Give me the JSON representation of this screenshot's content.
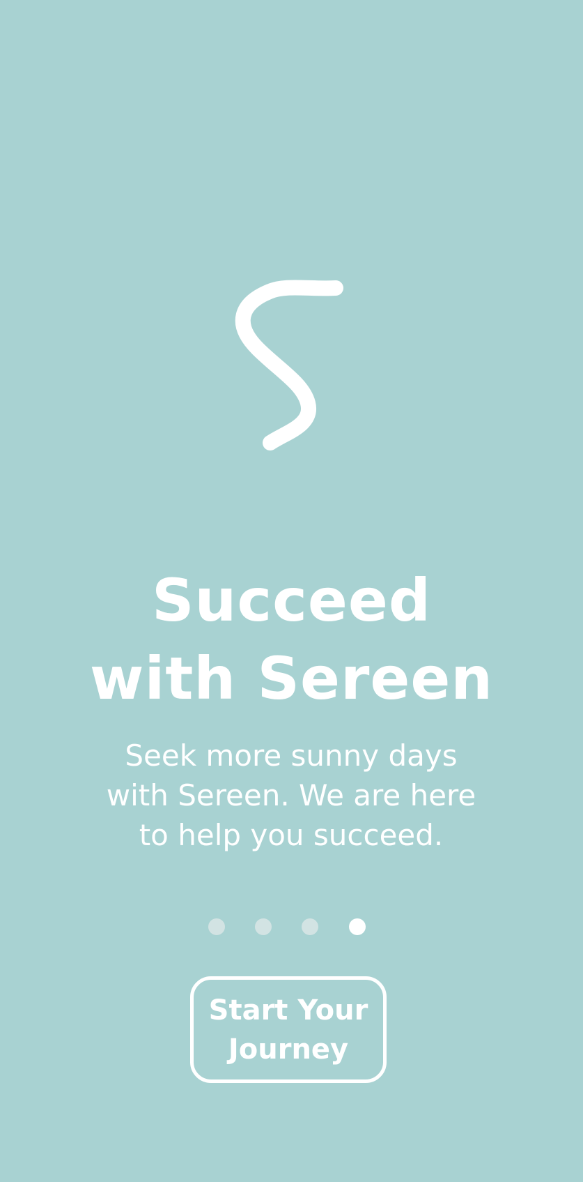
{
  "colors": {
    "background": "#a8d2d2",
    "foreground": "#ffffff",
    "dot_inactive": "#d2e3e3",
    "dot_active": "#ffffff"
  },
  "logo": {
    "icon": "sereen-s-logo-icon"
  },
  "onboarding": {
    "title_line1": "Succeed",
    "title_line2": "with Sereen",
    "description_lines": [
      "Seek more sunny days",
      "with Sereen. We are here",
      "to help you succeed."
    ]
  },
  "pager": {
    "total_pages": 4,
    "active_page": 4
  },
  "cta": {
    "label_line1": "Start Your",
    "label_line2": "Journey"
  }
}
